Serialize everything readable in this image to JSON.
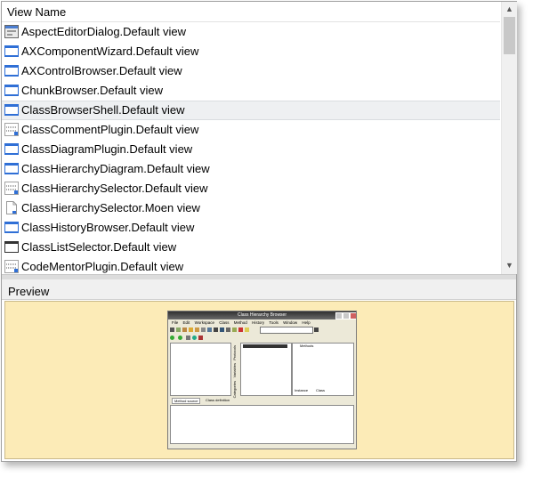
{
  "list": {
    "header": "View Name",
    "items": [
      {
        "label": "AspectEditorDialog.Default view",
        "icon": "dialog-window-icon",
        "selected": false
      },
      {
        "label": "AXComponentWizard.Default view",
        "icon": "window-icon",
        "selected": false
      },
      {
        "label": "AXControlBrowser.Default view",
        "icon": "window-icon",
        "selected": false
      },
      {
        "label": "ChunkBrowser.Default view",
        "icon": "window-icon",
        "selected": false
      },
      {
        "label": "ClassBrowserShell.Default view",
        "icon": "window-icon",
        "selected": true
      },
      {
        "label": "ClassCommentPlugin.Default view",
        "icon": "dotted-frame-icon",
        "selected": false
      },
      {
        "label": "ClassDiagramPlugin.Default view",
        "icon": "window-icon",
        "selected": false
      },
      {
        "label": "ClassHierarchyDiagram.Default view",
        "icon": "window-icon",
        "selected": false
      },
      {
        "label": "ClassHierarchySelector.Default view",
        "icon": "dotted-frame-icon",
        "selected": false
      },
      {
        "label": "ClassHierarchySelector.Moen view",
        "icon": "document-icon",
        "selected": false
      },
      {
        "label": "ClassHistoryBrowser.Default view",
        "icon": "window-icon",
        "selected": false
      },
      {
        "label": "ClassListSelector.Default view",
        "icon": "bare-window-icon",
        "selected": false
      },
      {
        "label": "CodeMentorPlugin.Default view",
        "icon": "dotted-frame-icon",
        "selected": false
      }
    ]
  },
  "preview": {
    "header": "Preview",
    "thumbnail": {
      "title": "Class Hierarchy Browser",
      "menu": [
        "File",
        "Edit",
        "Workspace",
        "Class",
        "Method",
        "History",
        "Tools",
        "Window",
        "Help"
      ],
      "side_tabs": [
        "Protocols",
        "Variables",
        "Categories"
      ],
      "right_header": "Methods",
      "right_footer_a": "Instance",
      "right_footer_b": "Class",
      "bottom_tabs": [
        "Method source",
        "Class definition"
      ]
    }
  },
  "colors": {
    "preview_background": "#fcebb7",
    "selection_background": "#eef0f2",
    "icon_blue": "#2f6fd6"
  }
}
